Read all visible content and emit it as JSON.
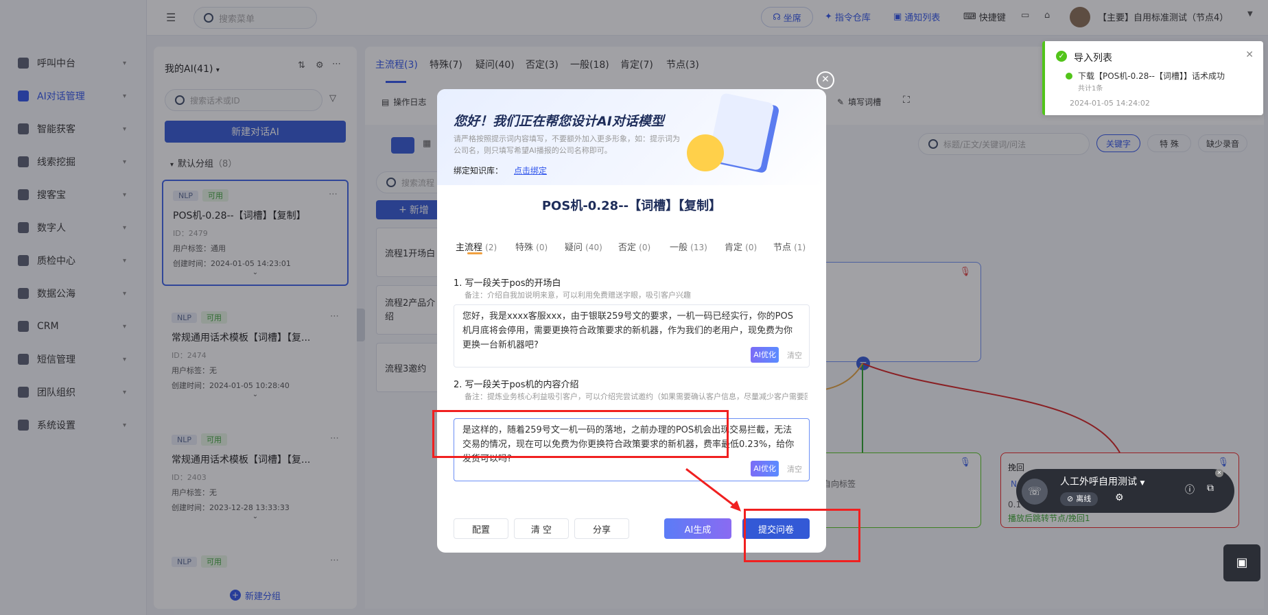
{
  "sidebar": {
    "items": [
      {
        "label": "呼叫中台",
        "icon": "monitor-icon"
      },
      {
        "label": "AI对话管理",
        "icon": "chat-icon",
        "active": true
      },
      {
        "label": "智能获客",
        "icon": "search-icon"
      },
      {
        "label": "线索挖掘",
        "icon": "target-icon"
      },
      {
        "label": "搜客宝",
        "icon": "search-icon"
      },
      {
        "label": "数字人",
        "icon": "person-icon"
      },
      {
        "label": "质检中心",
        "icon": "search-icon"
      },
      {
        "label": "数据公海",
        "icon": "chart-icon"
      },
      {
        "label": "CRM",
        "icon": "crm-icon"
      },
      {
        "label": "短信管理",
        "icon": "message-icon"
      },
      {
        "label": "团队组织",
        "icon": "team-icon"
      },
      {
        "label": "系统设置",
        "icon": "grid-icon"
      }
    ]
  },
  "topbar": {
    "search_placeholder": "搜索菜单",
    "seat": "坐席",
    "command_repo": "指令仓库",
    "notification_list": "通知列表",
    "shortcut": "快捷键",
    "account": "【主要】自用标准测试（节点4）"
  },
  "left_panel": {
    "title": "我的AI(41)",
    "search_placeholder": "搜索话术或ID",
    "new_button": "新建对话AI",
    "group": "默认分组",
    "group_count": "（8）",
    "new_group": "新建分组",
    "cards": [
      {
        "tag1": "NLP",
        "tag2": "可用",
        "title": "POS机-0.28--【词槽】【复制】",
        "id": "ID：2479",
        "label": "用户标签：通用",
        "time": "创建时间：2024-01-05 14:23:01"
      },
      {
        "tag1": "NLP",
        "tag2": "可用",
        "title": "常规通用话术模板【词槽】【复...",
        "id": "ID：2474",
        "label": "用户标签：无",
        "time": "创建时间：2024-01-05 10:28:40"
      },
      {
        "tag1": "NLP",
        "tag2": "可用",
        "title": "常规通用话术模板【词槽】【复...",
        "id": "ID：2403",
        "label": "用户标签：无",
        "time": "创建时间：2023-12-28 13:33:33"
      },
      {
        "tag1": "NLP",
        "tag2": "可用"
      }
    ]
  },
  "main": {
    "tabs": [
      "主流程(3)",
      "特殊(7)",
      "疑问(40)",
      "否定(3)",
      "一般(18)",
      "肯定(7)",
      "节点(3)"
    ],
    "op_log": "操作日志",
    "fill_slots": "填写词槽",
    "flow_search_placeholder": "搜索流程",
    "new_flow": "新增",
    "flows": [
      "流程1开场白",
      "流程2产品介绍",
      "流程3邀约"
    ],
    "kw_search_placeholder": "标题/正文/关键词/问法",
    "keyword_btn": "关键字",
    "special_btn": "特 殊",
    "missing_audio_btn": "缺少录音",
    "node_title": "挽回",
    "node_line1": "自向标签",
    "node_line2": "播放后跳转节点/挽回1",
    "node_partial_a": "N",
    "node_partial_b": "0.1"
  },
  "modal": {
    "greeting": "您好！我们正在帮您设计AI对话模型",
    "hint": "请严格按照提示词内容填写，不要额外加入更多形象，如：提示词为公司名，则只填写希望AI播报的公司名称即可。",
    "kb_label": "绑定知识库：",
    "kb_link": "点击绑定",
    "title": "POS机-0.28--【词槽】【复制】",
    "tabs": [
      {
        "label": "主流程",
        "count": "(2)"
      },
      {
        "label": "特殊",
        "count": "(0)"
      },
      {
        "label": "疑问",
        "count": "(40)"
      },
      {
        "label": "否定",
        "count": "(0)"
      },
      {
        "label": "一般",
        "count": "(13)"
      },
      {
        "label": "肯定",
        "count": "(0)"
      },
      {
        "label": "节点",
        "count": "(1)"
      }
    ],
    "q1_title": "1. 写一段关于pos的开场白",
    "q1_note": "备注：介绍自我加说明来意，可以利用免费赠送字眼，吸引客户兴趣",
    "q1_text": "您好，我是xxxx客服xxx，由于银联259号文的要求，一机一码已经实行，你的POS机月底将会停用，需要更换符合政策要求的新机器，作为我们的老用户，现免费为你更换一台新机器吧?",
    "q2_title": "2. 写一段关于pos机的内容介绍",
    "q2_note": "备注：提炼业务核心利益吸引客户，可以介绍完尝试邀约（如果需要确认客户信息，尽量减少客户需要回答的内容）",
    "q2_text": "是这样的，随着259号文一机一码的落地，之前办理的POS机会出现交易拦截，无法交易的情况，现在可以免费为你更换符合政策要求的新机器，费率最低0.23%，给你发货可以吗?",
    "ai_opt": "AI优化",
    "clear": "清空",
    "btn_config": "配置",
    "btn_clear": "清 空",
    "btn_share": "分享",
    "btn_ai_gen": "AI生成",
    "btn_submit": "提交问卷"
  },
  "notice": {
    "title": "导入列表",
    "item": "下载【POS机-0.28--【词槽】】话术成功",
    "sub": "共计1条",
    "time": "2024-01-05 14:24:02"
  },
  "callbar": {
    "name": "人工外呼自用测试",
    "status": "离线"
  },
  "colors": {
    "primary": "#3359d6",
    "success": "#52c41a",
    "danger": "#f02020"
  }
}
